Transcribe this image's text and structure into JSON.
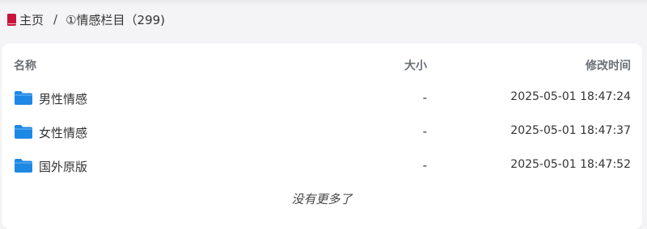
{
  "breadcrumb": {
    "home": "主页",
    "separator": "/",
    "current": "①情感栏目（299)"
  },
  "icons": {
    "home": "book-icon",
    "folder": "folder-icon"
  },
  "colors": {
    "folder": "#1e88e5",
    "home_icon": "#c8143c"
  },
  "table": {
    "columns": [
      "名称",
      "大小",
      "修改时间"
    ],
    "rows": [
      {
        "name": "男性情感",
        "size": "-",
        "modified": "2025-05-01 18:47:24"
      },
      {
        "name": "女性情感",
        "size": "-",
        "modified": "2025-05-01 18:47:37"
      },
      {
        "name": "国外原版",
        "size": "-",
        "modified": "2025-05-01 18:47:52"
      }
    ]
  },
  "footer": {
    "note": "没有更多了"
  }
}
